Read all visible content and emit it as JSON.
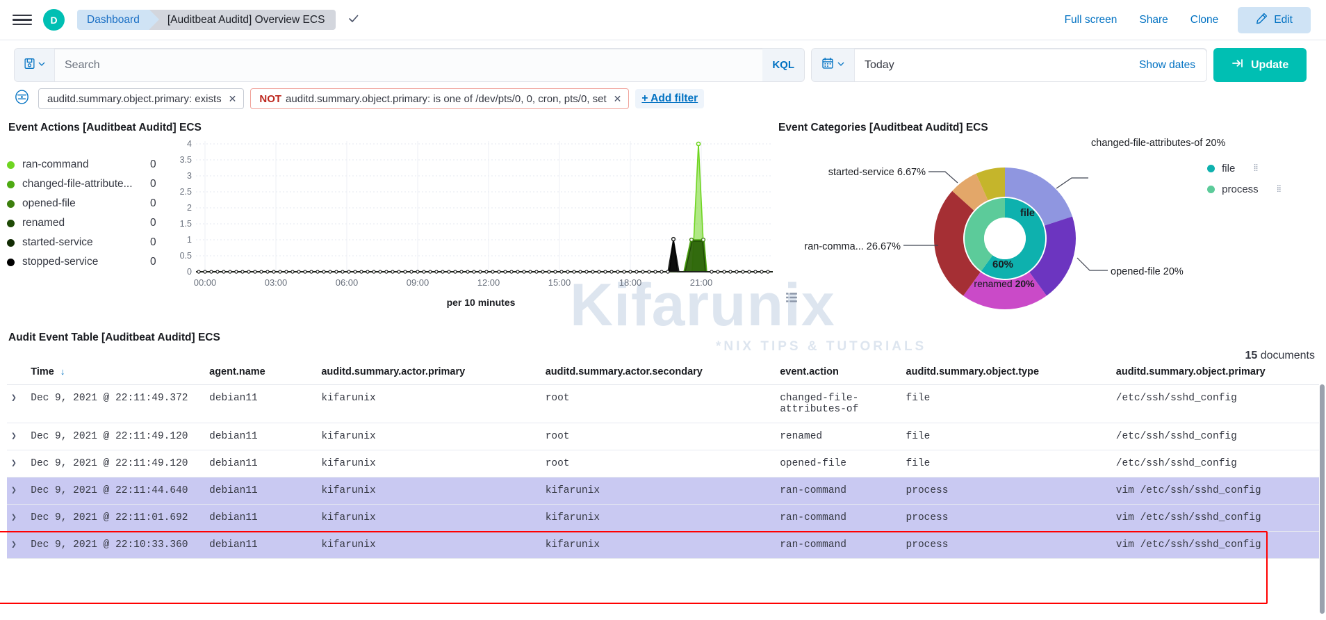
{
  "topnav": {
    "menu_icon": "hamburger-icon",
    "avatar_letter": "D",
    "breadcrumb_root": "Dashboard",
    "breadcrumb_current": "[Auditbeat Auditd] Overview ECS",
    "check_icon": "check-icon",
    "full_screen": "Full screen",
    "share": "Share",
    "clone": "Clone",
    "edit": "Edit",
    "edit_icon": "pencil-icon"
  },
  "querybar": {
    "saved_query_icon": "save-disk-icon",
    "saved_query_caret": "chevron-down-icon",
    "search_value": "",
    "search_placeholder": "Search",
    "kql_label": "KQL",
    "calendar_icon": "calendar-icon",
    "calendar_caret": "chevron-down-icon",
    "date_value": "Today",
    "show_dates": "Show dates",
    "update_label": "Update",
    "update_icon": "refresh-arrow-icon"
  },
  "filterbar": {
    "settings_icon": "filter-settings-icon",
    "filters": [
      {
        "negated": false,
        "neg_label": "",
        "text": "auditd.summary.object.primary: exists",
        "remove_icon": "close-icon"
      },
      {
        "negated": true,
        "neg_label": "NOT",
        "text": "auditd.summary.object.primary: is one of /dev/pts/0, 0, cron, pts/0, set",
        "remove_icon": "close-icon"
      }
    ],
    "add_filter": "+ Add filter"
  },
  "panels": {
    "left_title": "Event Actions [Auditbeat Auditd] ECS",
    "right_title": "Event Categories [Auditbeat Auditd] ECS",
    "left_menu_icon": "panel-context-menu-icon",
    "right_menu_icon": "panel-context-menu-icon",
    "left_list_icon": "legend-list-icon",
    "right_list_icon": "legend-list-icon"
  },
  "chart_data": [
    {
      "type": "line",
      "title": "Event Actions [Auditbeat Auditd] ECS",
      "xlabel": "per 10 minutes",
      "ylabel": "",
      "ylim": [
        0,
        4
      ],
      "yticks": [
        "0",
        "0.5",
        "1",
        "1.5",
        "2",
        "2.5",
        "3",
        "3.5",
        "4"
      ],
      "xticks": [
        "00:00",
        "03:00",
        "06:00",
        "09:00",
        "12:00",
        "15:00",
        "18:00",
        "21:00"
      ],
      "grid": true,
      "legend_position": "left",
      "legend": [
        {
          "name": "ran-command",
          "value": "0",
          "color": "#6fd521"
        },
        {
          "name": "changed-file-attribute...",
          "full_name": "changed-file-attributes-of",
          "value": "0",
          "color": "#4eaa12"
        },
        {
          "name": "opened-file",
          "value": "0",
          "color": "#3c7f0d"
        },
        {
          "name": "renamed",
          "value": "0",
          "color": "#1f4a06"
        },
        {
          "name": "started-service",
          "value": "0",
          "color": "#122c04"
        },
        {
          "name": "stopped-service",
          "value": "0",
          "color": "#000000"
        }
      ],
      "series": [
        {
          "name": "ran-command",
          "color": "#6fd521",
          "peak_time": "21:40",
          "peak_value": 4
        },
        {
          "name": "changed-file-attributes-of",
          "color": "#4eaa12",
          "peak_time": "21:40",
          "peak_value": 1
        },
        {
          "name": "opened-file",
          "color": "#3c7f0d",
          "peak_time": "21:40",
          "peak_value": 1
        },
        {
          "name": "renamed",
          "color": "#1f4a06",
          "peak_time": "21:40",
          "peak_value": 1
        },
        {
          "name": "started-service",
          "color": "#122c04",
          "peak_time": "21:20",
          "peak_value": 1
        },
        {
          "name": "stopped-service",
          "color": "#000000",
          "peak_time": "21:20",
          "peak_value": 1
        }
      ],
      "note": "All series are flat at 0 across the day except a spike near 21:20-21:50"
    },
    {
      "type": "pie",
      "subtype": "donut-multilevel",
      "title": "Event Categories [Auditbeat Auditd] ECS",
      "inner_ring": [
        {
          "label": "file",
          "percent": 60,
          "display": "60%",
          "color": "#0eb1ae"
        },
        {
          "label": "process",
          "percent": 40,
          "display": "",
          "color": "#5ccb9a"
        }
      ],
      "outer_ring": [
        {
          "label": "changed-file-attributes-of",
          "percent": 20,
          "display": "changed-file-attributes-of  20%",
          "color": "#8f96e0"
        },
        {
          "label": "opened-file",
          "percent": 20,
          "display": "opened-file  20%",
          "color": "#6c35c0"
        },
        {
          "label": "renamed",
          "percent": 20,
          "display": "renamed 20%",
          "color": "#ca4ac8"
        },
        {
          "label": "ran-comma...",
          "percent": 26.67,
          "display": "ran-comma...  26.67%",
          "color": "#a52f34"
        },
        {
          "label": "started-service",
          "percent": 6.67,
          "display": "started-service  6.67%",
          "color": "#e3a769"
        },
        {
          "label": "stopped-service",
          "percent": 6.66,
          "display": "",
          "color": "#c5b52b"
        }
      ],
      "legend": [
        {
          "name": "file",
          "color": "#0eb1ae"
        },
        {
          "name": "process",
          "color": "#5ccb9a"
        }
      ],
      "legend_position": "right",
      "center_label": "file",
      "center_value": "60%"
    }
  ],
  "table": {
    "title": "Audit Event Table [Auditbeat Auditd] ECS",
    "doc_count_number": "15",
    "doc_count_label": "documents",
    "sort_icon": "sort-down-arrow",
    "expand_icon": "chevron-right-icon",
    "columns": [
      "Time",
      "agent.name",
      "auditd.summary.actor.primary",
      "auditd.summary.actor.secondary",
      "event.action",
      "auditd.summary.object.type",
      "auditd.summary.object.primary"
    ],
    "rows": [
      {
        "time": "Dec 9, 2021 @ 22:11:49.372",
        "agent_name": "debian11",
        "actor_primary": "kifarunix",
        "actor_secondary": "root",
        "event_action": "changed-file-attributes-of",
        "object_type": "file",
        "object_primary": "/etc/ssh/sshd_config",
        "highlighted": false
      },
      {
        "time": "Dec 9, 2021 @ 22:11:49.120",
        "agent_name": "debian11",
        "actor_primary": "kifarunix",
        "actor_secondary": "root",
        "event_action": "renamed",
        "object_type": "file",
        "object_primary": "/etc/ssh/sshd_config",
        "highlighted": false
      },
      {
        "time": "Dec 9, 2021 @ 22:11:49.120",
        "agent_name": "debian11",
        "actor_primary": "kifarunix",
        "actor_secondary": "root",
        "event_action": "opened-file",
        "object_type": "file",
        "object_primary": "/etc/ssh/sshd_config",
        "highlighted": false
      },
      {
        "time": "Dec 9, 2021 @ 22:11:44.640",
        "agent_name": "debian11",
        "actor_primary": "kifarunix",
        "actor_secondary": "kifarunix",
        "event_action": "ran-command",
        "object_type": "process",
        "object_primary": "vim /etc/ssh/sshd_config",
        "highlighted": true
      },
      {
        "time": "Dec 9, 2021 @ 22:11:01.692",
        "agent_name": "debian11",
        "actor_primary": "kifarunix",
        "actor_secondary": "kifarunix",
        "event_action": "ran-command",
        "object_type": "process",
        "object_primary": "vim /etc/ssh/sshd_config",
        "highlighted": true
      },
      {
        "time": "Dec 9, 2021 @ 22:10:33.360",
        "agent_name": "debian11",
        "actor_primary": "kifarunix",
        "actor_secondary": "kifarunix",
        "event_action": "ran-command",
        "object_type": "process",
        "object_primary": "vim /etc/ssh/sshd_config",
        "highlighted": true
      }
    ]
  },
  "watermark": {
    "main": "Kifarunix",
    "sub": "*NIX TIPS & TUTORIALS"
  },
  "colors": {
    "accent_teal": "#00bfb3",
    "link_blue": "#0071c2",
    "negated_red": "#bd271e",
    "highlight_row": "#c9c9f2",
    "redbox": "#ff0000"
  }
}
